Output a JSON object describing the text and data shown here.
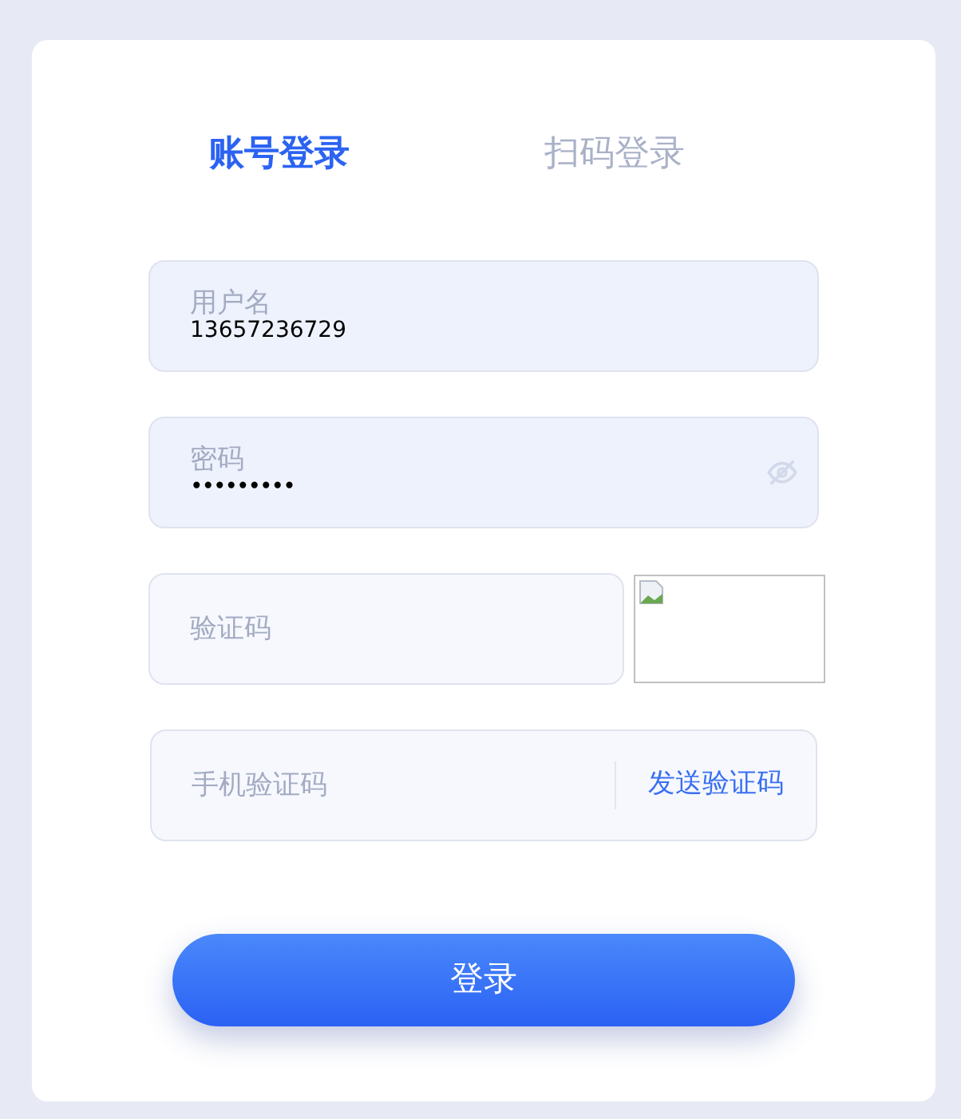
{
  "tabs": [
    {
      "label": "账号登录",
      "selected": true
    },
    {
      "label": "扫码登录",
      "selected": false
    }
  ],
  "fields": [
    {
      "kind": "text",
      "placeholder": "用户名",
      "value": "13657236729"
    },
    {
      "kind": "password",
      "placeholder": "密码",
      "value": "•••••••••"
    },
    {
      "kind": "captcha",
      "placeholder": "验证码"
    },
    {
      "kind": "sms",
      "placeholder": "手机验证码",
      "action": "发送验证码"
    }
  ],
  "submit": "登录"
}
